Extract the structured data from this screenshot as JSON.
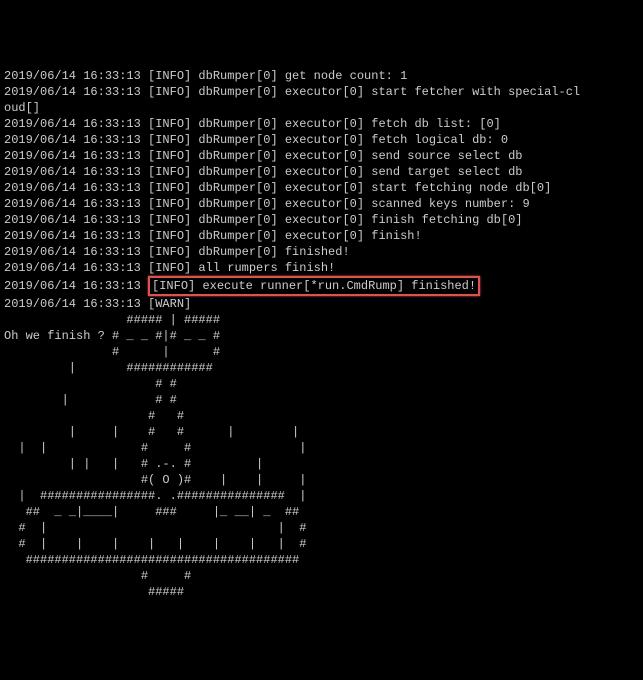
{
  "logs": [
    {
      "ts": "2019/06/14 16:33:13",
      "lvl": "[INFO]",
      "src": "dbRumper[0]",
      "msg": "get node count: 1"
    },
    {
      "ts": "2019/06/14 16:33:13",
      "lvl": "[INFO]",
      "src": "dbRumper[0]",
      "msg": "executor[0] start fetcher with special-cloud[]",
      "wrap": true
    },
    {
      "ts": "2019/06/14 16:33:13",
      "lvl": "[INFO]",
      "src": "dbRumper[0]",
      "msg": "executor[0] fetch db list: [0]"
    },
    {
      "ts": "2019/06/14 16:33:13",
      "lvl": "[INFO]",
      "src": "dbRumper[0]",
      "msg": "executor[0] fetch logical db: 0"
    },
    {
      "ts": "2019/06/14 16:33:13",
      "lvl": "[INFO]",
      "src": "dbRumper[0]",
      "msg": "executor[0] send source select db"
    },
    {
      "ts": "2019/06/14 16:33:13",
      "lvl": "[INFO]",
      "src": "dbRumper[0]",
      "msg": "executor[0] send target select db"
    },
    {
      "ts": "2019/06/14 16:33:13",
      "lvl": "[INFO]",
      "src": "dbRumper[0]",
      "msg": "executor[0] start fetching node db[0]"
    },
    {
      "ts": "2019/06/14 16:33:13",
      "lvl": "[INFO]",
      "src": "dbRumper[0]",
      "msg": "executor[0] scanned keys number: 9"
    },
    {
      "ts": "2019/06/14 16:33:13",
      "lvl": "[INFO]",
      "src": "dbRumper[0]",
      "msg": "executor[0] finish fetching db[0]"
    },
    {
      "ts": "2019/06/14 16:33:13",
      "lvl": "[INFO]",
      "src": "dbRumper[0]",
      "msg": "executor[0] finish!"
    },
    {
      "ts": "2019/06/14 16:33:13",
      "lvl": "[INFO]",
      "src": "dbRumper[0]",
      "msg": "finished!"
    },
    {
      "ts": "2019/06/14 16:33:13",
      "lvl": "[INFO]",
      "src": "",
      "msg": "all rumpers finish!"
    }
  ],
  "highlighted": {
    "ts": "2019/06/14 16:33:13",
    "lvl": "[INFO]",
    "msg": "execute runner[*run.CmdRump] finished!"
  },
  "warn": {
    "ts": "2019/06/14 16:33:13",
    "lvl": "[WARN]"
  },
  "ascii": "                 ##### | #####\nOh we finish ? # _ _ #|# _ _ #\n               #      |      #\n         |       ############\n                     # #\n        |            # #\n                    #   #\n         |     |    #   #      |        |\n  |  |             #     #               |\n         | |   |   # .-. #         |\n                   #( O )#    |    |     |\n  |  ################. .###############  |\n   ##  _ _|____|     ###     |_ __| _  ##\n  #  |                                |  #\n  #  |    |    |    |   |    |    |   |  #\n   ######################################\n                   #     #\n                    #####"
}
